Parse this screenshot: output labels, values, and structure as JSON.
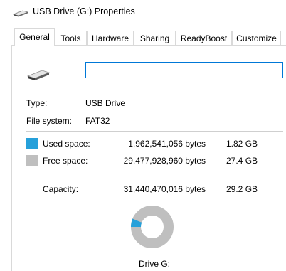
{
  "window": {
    "title": "USB Drive (G:) Properties"
  },
  "tabs": [
    "General",
    "Tools",
    "Hardware",
    "Sharing",
    "ReadyBoost",
    "Customize"
  ],
  "general": {
    "name_value": "",
    "type_label": "Type:",
    "type_value": "USB Drive",
    "fs_label": "File system:",
    "fs_value": "FAT32",
    "used_label": "Used space:",
    "used_bytes": "1,962,541,056 bytes",
    "used_size": "1.82 GB",
    "free_label": "Free space:",
    "free_bytes": "29,477,928,960 bytes",
    "free_size": "27.4 GB",
    "capacity_label": "Capacity:",
    "capacity_bytes": "31,440,470,016 bytes",
    "capacity_size": "29.2 GB",
    "drive_label": "Drive G:"
  },
  "usage": {
    "used_fraction": 0.0624
  },
  "colors": {
    "used": "#26a0da",
    "free": "#bfbfbf"
  },
  "icons": {
    "title": "usb-drive-icon",
    "drive": "usb-drive-icon"
  }
}
